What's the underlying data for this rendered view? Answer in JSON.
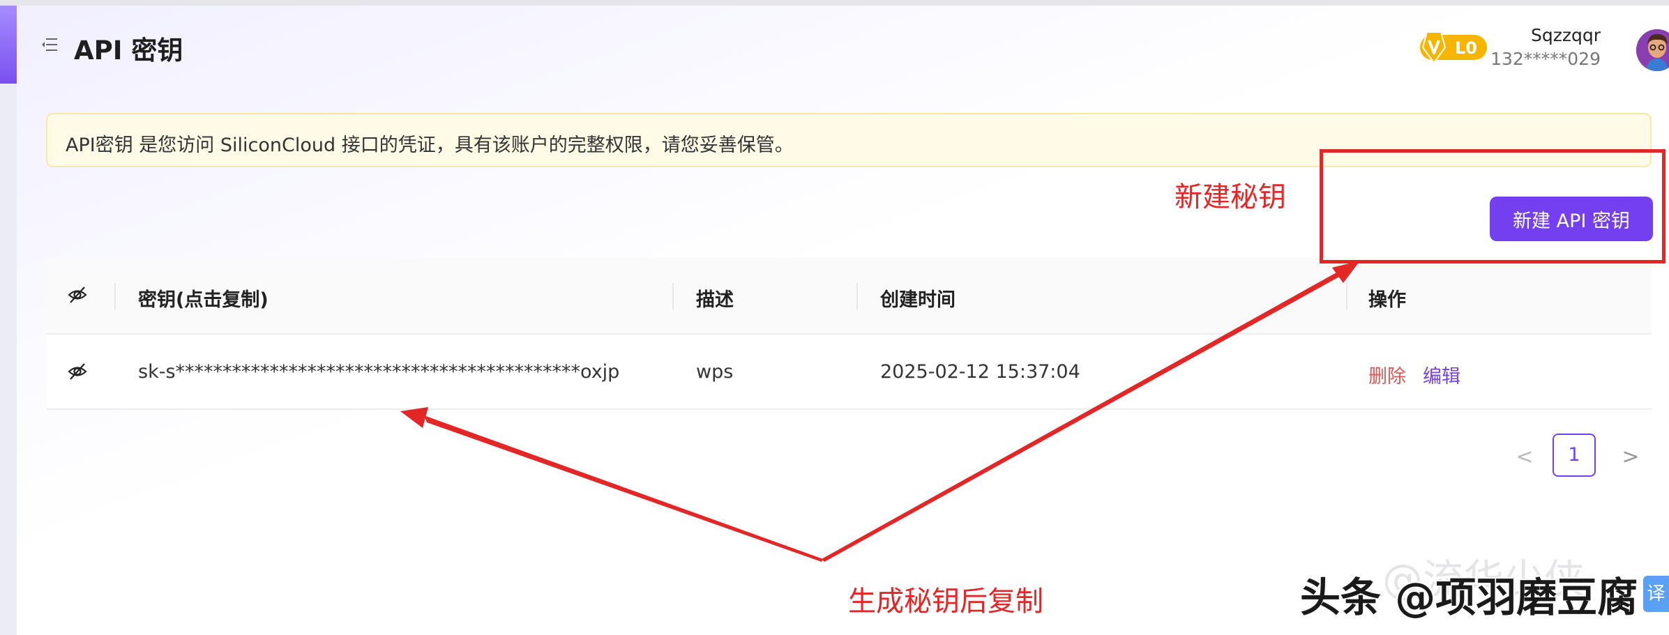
{
  "header": {
    "title": "API 密钥",
    "level_badge": "L0",
    "user_name": "Sqzzqqr",
    "user_phone": "132*****029"
  },
  "notice": {
    "text": "API密钥 是您访问 SiliconCloud 接口的凭证，具有该账户的完整权限，请您妥善保管。"
  },
  "toolbar": {
    "new_key_label": "新建 API 密钥"
  },
  "table": {
    "columns": {
      "key": "密钥(点击复制)",
      "description": "描述",
      "created_at": "创建时间",
      "actions": "操作"
    },
    "rows": [
      {
        "key": "sk-s*******************************************oxjp",
        "description": "wps",
        "created_at": "2025-02-12 15:37:04",
        "delete_label": "删除",
        "edit_label": "编辑"
      }
    ]
  },
  "pagination": {
    "prev": "<",
    "current_page": "1",
    "next": ">"
  },
  "annotations": {
    "new_key_label": "新建秘钥",
    "copy_label": "生成秘钥后复制"
  },
  "watermark": {
    "text": "头条 @项羽磨豆腐",
    "faint_text": "@流华少侠",
    "corner_tag": "译"
  },
  "colors": {
    "primary": "#7440ef",
    "danger": "#e05656",
    "annotation_red": "#e32626",
    "notice_bg": "#fffbe6"
  }
}
